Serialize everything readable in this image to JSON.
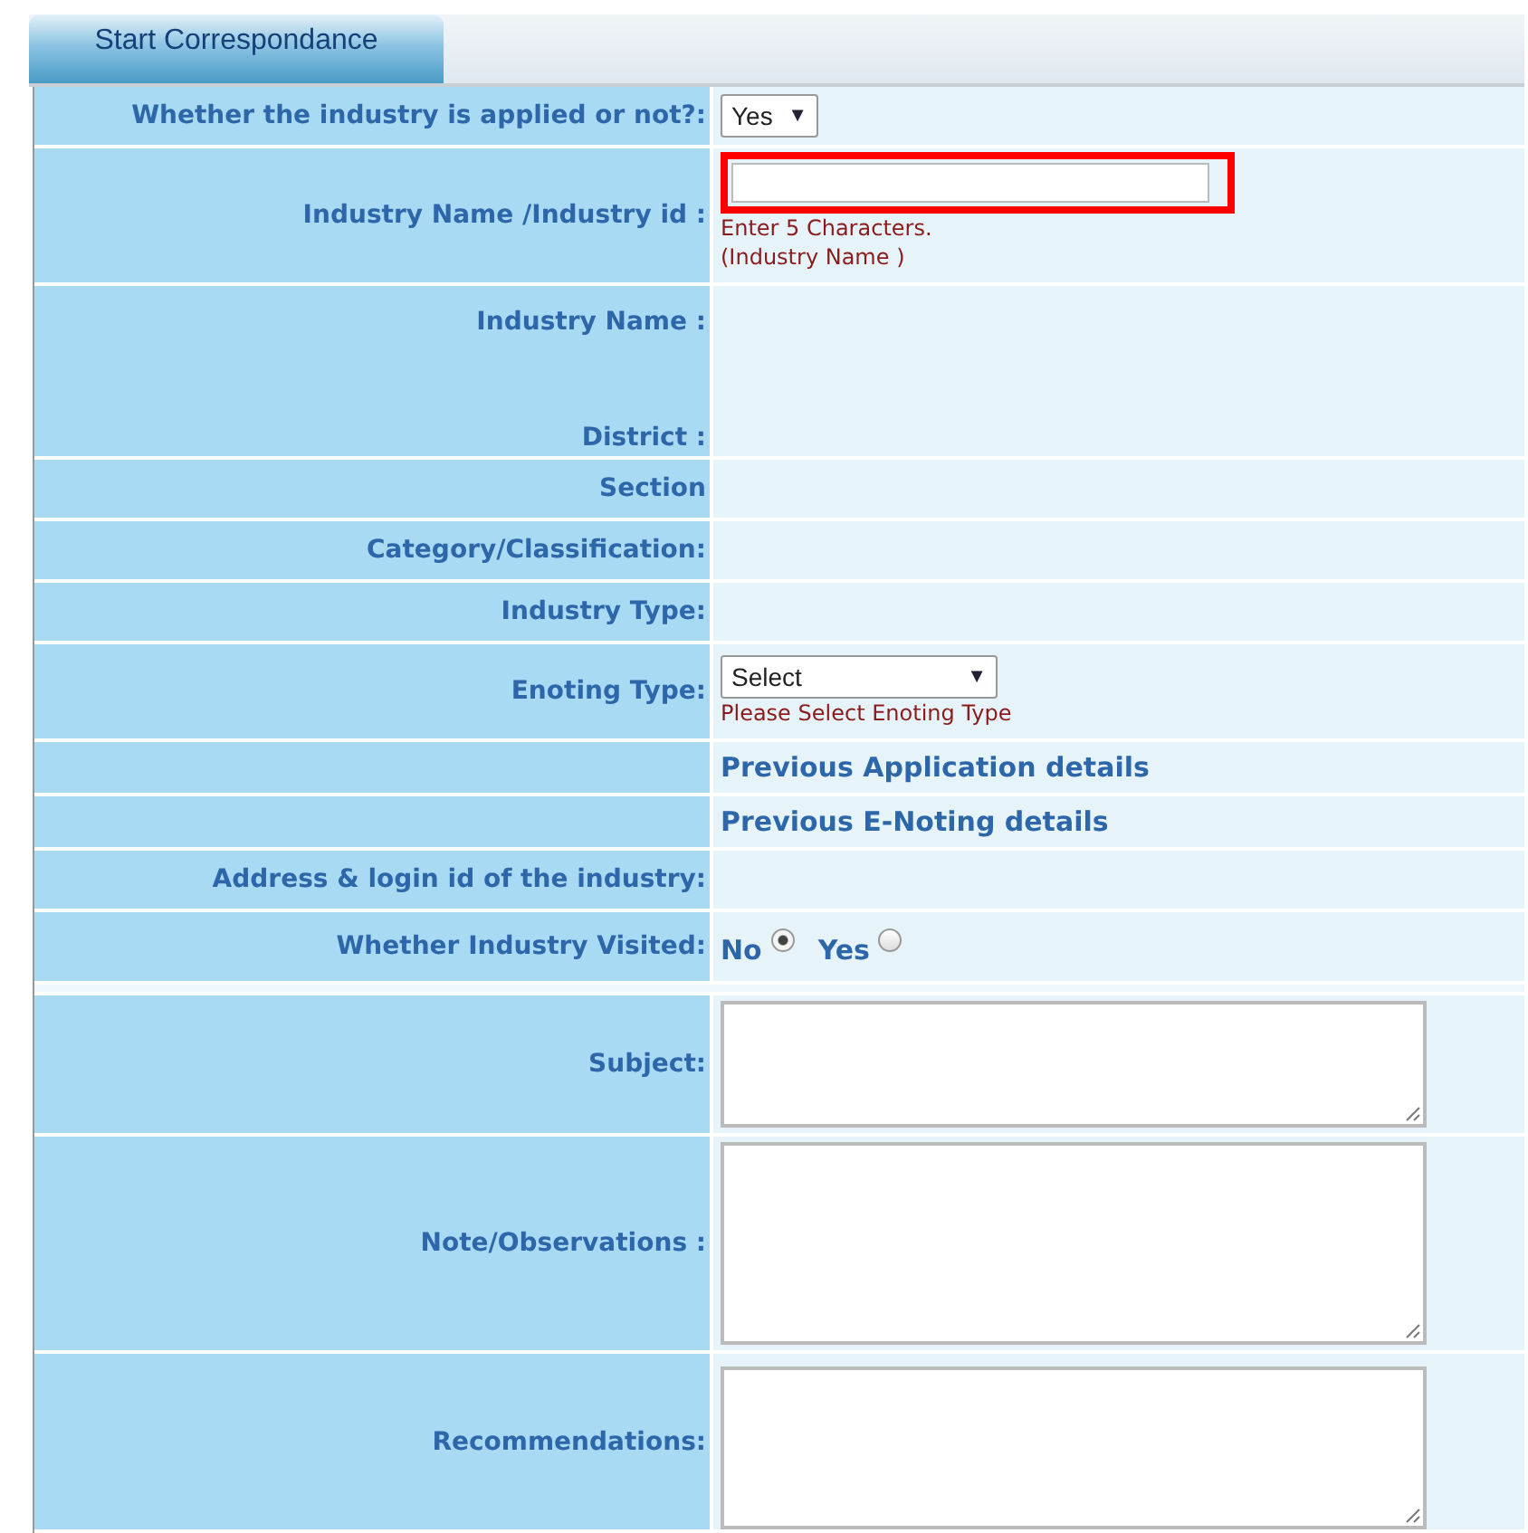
{
  "tab": {
    "label": "Start Correspondance",
    "selected": true
  },
  "rows": [
    {
      "kind": "select",
      "labels": [
        "Whether the industry is applied or not?:"
      ],
      "value": "Yes",
      "caret": "▼"
    },
    {
      "kind": "text",
      "labels": [
        "Industry Name /Industry id :"
      ],
      "highlighted": true,
      "hints": [
        "Enter 5 Characters.",
        "(Industry Name )"
      ]
    },
    {
      "kind": "info",
      "labels": [
        "Industry Name :",
        "District :"
      ]
    },
    {
      "kind": "info",
      "labels": [
        "Section"
      ]
    },
    {
      "kind": "info",
      "labels": [
        "Category/Classification:"
      ]
    },
    {
      "kind": "info",
      "labels": [
        "Industry Type:"
      ]
    },
    {
      "kind": "select",
      "labels": [
        "Enoting Type:"
      ],
      "value": "Select",
      "caret": "▼",
      "hints": [
        "Please Select Enoting Type"
      ]
    },
    {
      "kind": "link",
      "link": "Previous Application details"
    },
    {
      "kind": "link",
      "link": "Previous E-Noting details"
    },
    {
      "kind": "info",
      "labels": [
        "Address & login id of the industry:"
      ]
    },
    {
      "kind": "radio",
      "labels": [
        "Whether Industry Visited:"
      ],
      "options": [
        {
          "label": "No",
          "selected": true
        },
        {
          "label": "Yes",
          "selected": false
        }
      ]
    },
    {
      "kind": "spacer"
    },
    {
      "kind": "textarea",
      "labels": [
        "Subject:"
      ]
    },
    {
      "kind": "textarea",
      "labels": [
        "Note/Observations :"
      ]
    },
    {
      "kind": "textarea",
      "labels": [
        "Recommendations:"
      ]
    }
  ]
}
